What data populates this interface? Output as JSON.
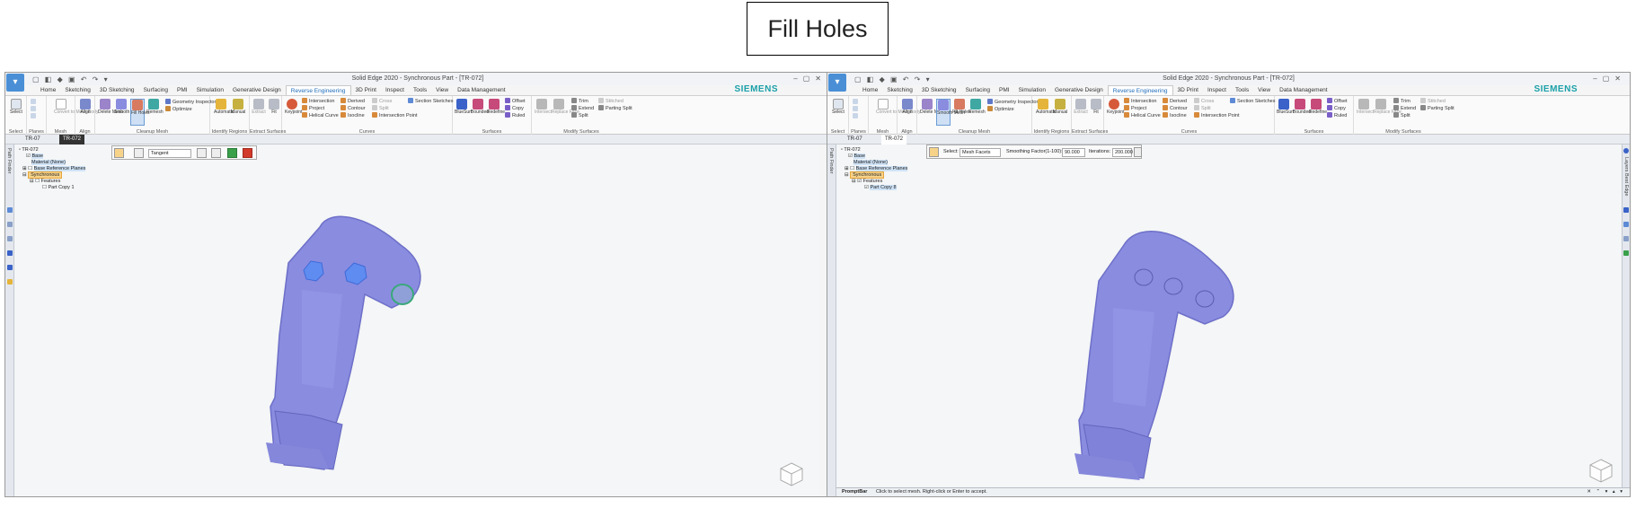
{
  "slide_title": "Fill Holes",
  "left_window": {
    "window_title": "Solid Edge 2020 - Synchronous Part - [TR-072]",
    "ribbon_tabs": [
      "Home",
      "Sketching",
      "3D Sketching",
      "Surfacing",
      "PMI",
      "Simulation",
      "Generative Design",
      "Reverse Engineering",
      "3D Print",
      "Inspect",
      "Tools",
      "View",
      "Data Management"
    ],
    "active_tab": "Reverse Engineering",
    "brand": "SIEMENS",
    "groups": {
      "select": {
        "name": "Select",
        "btn": "Select"
      },
      "planes": {
        "name": "Planes"
      },
      "mesh": {
        "name": "Mesh",
        "btn": "Convert to Mesh Body"
      },
      "align": {
        "name": "Align",
        "btn": "Align"
      },
      "cleanup": {
        "name": "Cleanup Mesh",
        "btns": [
          "Delete Mesh",
          "Smooth Mesh",
          "Fill Holes",
          "Remesh"
        ],
        "smalls": [
          "Geometry Inspector",
          "Optimize"
        ]
      },
      "identify": {
        "name": "Identify Regions",
        "btns": [
          "Automatic",
          "Manual"
        ]
      },
      "extract": {
        "name": "Extract Surfaces",
        "btns": [
          "Extract",
          "Fit"
        ]
      },
      "curves": {
        "name": "Curves",
        "btn": "Keypoint",
        "smalls": [
          "Intersection",
          "Project",
          "Helical Curve",
          "Derived",
          "Contour",
          "Isocline",
          "Cross",
          "Split",
          "Intersection Point",
          "Section Sketches"
        ]
      },
      "surfaces": {
        "name": "Surfaces",
        "btns": [
          "BlueSurf",
          "Bounded",
          "Redefine"
        ],
        "smalls": [
          "Offset",
          "Copy",
          "Ruled"
        ]
      },
      "modify": {
        "name": "Modify Surfaces",
        "btns": [
          "Intersect",
          "Replace Face"
        ],
        "smalls": [
          "Trim",
          "Extend",
          "Split",
          "Stitched",
          "Parting Split"
        ]
      }
    },
    "doc_tabs": [
      "TR-07",
      "TR-072"
    ],
    "strip_label": "Path Finder",
    "tree": {
      "root": "TR-072",
      "base": "Base",
      "material": "Material (None)",
      "refplanes": "Base Reference Planes",
      "sync": "Synchronous",
      "features": "Features",
      "partcopy": "Part Copy 1"
    },
    "cmd": {
      "dropdown": "Tangent"
    }
  },
  "right_window": {
    "window_title": "Solid Edge 2020 - Synchronous Part - [TR-072]",
    "ribbon_tabs": [
      "Home",
      "Sketching",
      "3D Sketching",
      "Surfacing",
      "PMI",
      "Simulation",
      "Generative Design",
      "Reverse Engineering",
      "3D Print",
      "Inspect",
      "Tools",
      "View",
      "Data Management"
    ],
    "active_tab": "Reverse Engineering",
    "brand": "SIEMENS",
    "doc_tabs": [
      "TR-07",
      "TR-072"
    ],
    "strip_label": "Path Finder",
    "right_strip_label": "Layers Best Edge",
    "tree": {
      "root": "TR-072",
      "base": "Base",
      "material": "Material (None)",
      "refplanes": "Base Reference Planes",
      "sync": "Synchronous",
      "features": "Features",
      "partcopy": "Part Copy 8"
    },
    "cmd": {
      "select_label": "Select:",
      "select_value": "Mesh Facets",
      "smooth_label": "Smoothing Factor(1-100):",
      "smooth_value": "90.000",
      "iter_label": "Iterations:",
      "iter_value": "200.000"
    },
    "prompt_label": "PromptBar",
    "prompt_text": "Click to select mesh. Right-click or Enter to accept."
  },
  "colors": {
    "model": "#8a8ce0",
    "hole_fill": "#5f8cf0",
    "accent": "#1e6bb8",
    "brand": "#1aa0a8"
  }
}
